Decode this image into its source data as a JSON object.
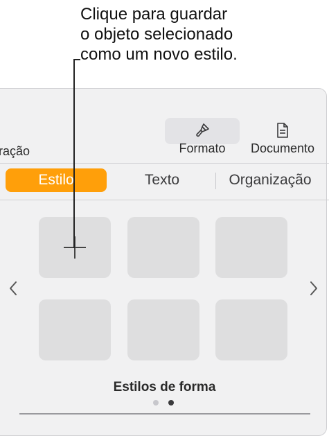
{
  "callout": {
    "lines": [
      "Clique para guardar",
      "o objeto selecionado",
      "como um novo estilo."
    ]
  },
  "toolbar": {
    "cut_label": "ração",
    "format_label": "Formato",
    "format_icon": "paintbrush-icon",
    "document_label": "Documento",
    "document_icon": "document-icon"
  },
  "tabs": [
    {
      "label": "Estilo",
      "active": true
    },
    {
      "label": "Texto",
      "active": false
    },
    {
      "label": "Organização",
      "active": false
    }
  ],
  "styles": {
    "add_icon": "plus-icon",
    "tile_count": 6,
    "prev_label": "‹",
    "next_label": "›",
    "caption": "Estilos de forma",
    "page_count": 2,
    "current_page": 2
  },
  "colors": {
    "accent": "#ff9f0a",
    "panel_bg": "#f1f1f2",
    "tile_bg": "#dededf"
  }
}
